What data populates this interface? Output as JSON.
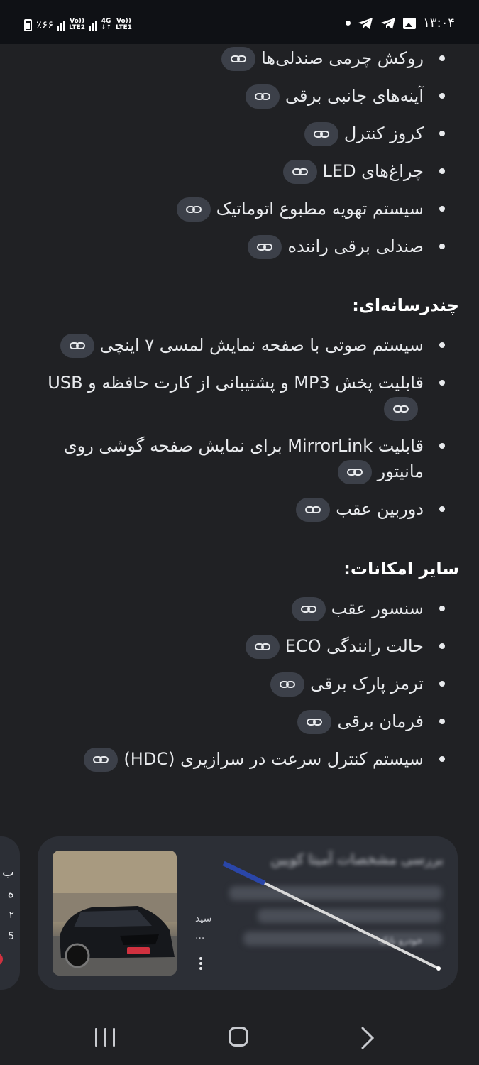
{
  "status_bar": {
    "battery": "٪۶۶",
    "net1_top": "Vo))",
    "net1_bottom": "LTE2",
    "net2_top": "4G",
    "net2_bottom": "↓↑",
    "net3_top": "Vo))",
    "net3_bottom": "LTE1",
    "time": "۱۳:۰۴"
  },
  "sections": {
    "comfort_items": [
      {
        "label": "روکش چرمی صندلی‌ها"
      },
      {
        "label": "آینه‌های جانبی برقی"
      },
      {
        "label": "کروز کنترل"
      },
      {
        "label": "چراغ‌های LED"
      },
      {
        "label": "سیستم تهویه مطبوع اتوماتیک"
      },
      {
        "label": "صندلی برقی راننده"
      }
    ],
    "multimedia_title": "چندرسانه‌ای:",
    "multimedia_items": [
      {
        "label": "سیستم صوتی با صفحه نمایش لمسی ۷ اینچی"
      },
      {
        "label": "قابلیت پخش MP3 و پشتیبانی از کارت حافظه و USB"
      },
      {
        "label": "قابلیت MirrorLink برای نمایش صفحه گوشی روی مانیتور"
      },
      {
        "label": "دوربین عقب"
      }
    ],
    "other_title": "سایر امکانات:",
    "other_items": [
      {
        "label": "سنسور عقب"
      },
      {
        "label": "حالت رانندگی ECO"
      },
      {
        "label": "ترمز پارک برقی"
      },
      {
        "label": "فرمان برقی"
      },
      {
        "label": "سیستم کنترل سرعت در سرازیری (HDC)"
      }
    ]
  },
  "cards": {
    "main_title": "بررسی مشخصات آمیتا کویین",
    "main_source": "خودرو بانک",
    "left_fragment_1": "سید",
    "left_fragment_2": "...",
    "side_line_1": "ب",
    "side_line_2": "ه",
    "side_line_3": "۲",
    "side_line_4": "5"
  },
  "icons": {
    "link": "link-icon",
    "telegram": "telegram-icon",
    "gallery": "gallery-icon",
    "more": "more-vertical-icon"
  }
}
